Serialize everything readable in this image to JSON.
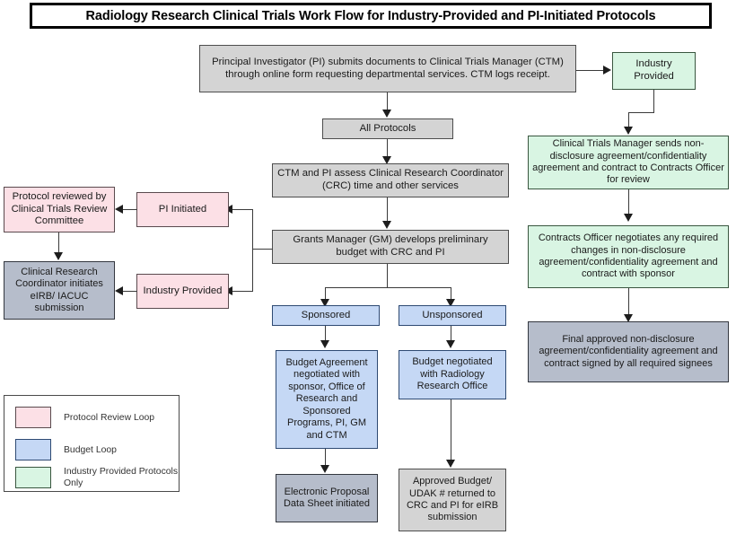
{
  "title": "Radiology Research Clinical Trials Work Flow for Industry-Provided and PI-Initiated Protocols",
  "nodes": {
    "pi_submits": "Principal Investigator (PI) submits documents to Clinical Trials Manager (CTM) through online form requesting departmental services. CTM logs receipt.",
    "all_protocols": "All Protocols",
    "ctm_assess": "CTM and PI assess Clinical Research Coordinator (CRC) time and other services",
    "grants_manager": "Grants Manager (GM) develops preliminary budget with CRC and PI",
    "sponsored": "Sponsored",
    "unsponsored": "Unsponsored",
    "budget_agreement": "Budget Agreement negotiated with sponsor, Office of Research and Sponsored Programs, PI, GM and CTM",
    "budget_negotiated": "Budget negotiated with Radiology Research Office",
    "electronic_proposal": "Electronic Proposal Data Sheet initiated",
    "approved_budget": "Approved Budget/ UDAK # returned to CRC and PI for eIRB submission",
    "pi_initiated": "PI Initiated",
    "industry_provided_left": "Industry Provided",
    "protocol_reviewed": "Protocol reviewed by Clinical Trials Review Committee",
    "crc_initiates": "Clinical Research Coordinator initiates eIRB/ IACUC submission",
    "industry_provided_top": "Industry Provided",
    "ctm_sends": "Clinical Trials Manager sends non-disclosure agreement/confidentiality agreement and contract to Contracts Officer for review",
    "contracts_officer": "Contracts Officer negotiates any required changes in non-disclosure agreement/confidentiality agreement and contract with sponsor",
    "final_approved": "Final approved non-disclosure agreement/confidentiality agreement and contract signed by all required signees"
  },
  "legend": {
    "items": [
      {
        "label": "Protocol Review Loop",
        "color": "#fce0e6"
      },
      {
        "label": "Budget Loop",
        "color": "#c5d8f5"
      },
      {
        "label": "Industry Provided Protocols Only",
        "color": "#d9f5e3"
      }
    ]
  },
  "colors": {
    "gray_fill": "#d4d4d4",
    "pink_fill": "#fce0e6",
    "blue_fill": "#c5d8f5",
    "green_fill": "#d9f5e3",
    "slate_fill": "#b6bdcb",
    "line": "#3a3a3a"
  }
}
